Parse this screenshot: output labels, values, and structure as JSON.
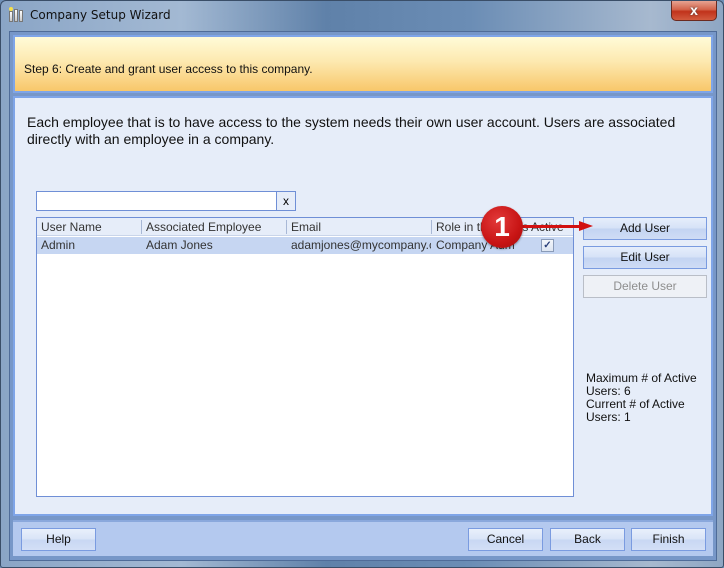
{
  "window": {
    "title": "Company Setup Wizard",
    "close_label": "x"
  },
  "header": {
    "step_text": "Step 6: Create and grant user access to this company."
  },
  "content": {
    "intro": "Each employee that is to have access to the system needs their own user account. Users are associated directly with an employee in a company.",
    "search": {
      "value": "",
      "placeholder": "",
      "clear_label": "x"
    },
    "grid": {
      "columns": [
        "User Name",
        "Associated Employee",
        "Email",
        "Role in this Company",
        "Is Active"
      ],
      "rows": [
        {
          "user_name": "Admin",
          "employee": "Adam Jones",
          "email": "adamjones@mycompany.c...",
          "role": "Company Admi...",
          "is_active": true,
          "is_active_glyph": "✓"
        }
      ]
    },
    "actions": {
      "add_user": "Add User",
      "edit_user": "Edit User",
      "delete_user": "Delete User"
    },
    "stats": {
      "max_label": "Maximum # of Active Users: 6",
      "current_label": "Current # of Active Users: 1",
      "max_active_users": 6,
      "current_active_users": 1
    },
    "annotation": {
      "badge_number": "1",
      "color": "#d21010"
    }
  },
  "footer": {
    "help": "Help",
    "cancel": "Cancel",
    "back": "Back",
    "finish": "Finish"
  }
}
